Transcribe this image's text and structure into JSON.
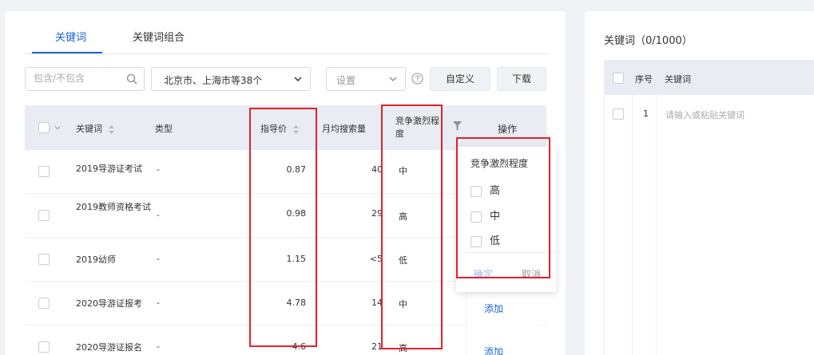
{
  "tabs": [
    {
      "label": "关键词",
      "active": true
    },
    {
      "label": "关键词组合",
      "active": false
    }
  ],
  "toolbar": {
    "search_placeholder": "包含/不包含",
    "region_value": "北京市、上海市等38个",
    "setting_placeholder": "设置",
    "custom_label": "自定义",
    "download_label": "下载"
  },
  "table": {
    "headers": {
      "keyword": "关键词",
      "type": "类型",
      "price": "指导价",
      "volume": "月均搜索量",
      "competition": "竞争激烈程度",
      "operation": "操作"
    },
    "rows": [
      {
        "keyword": "2019导游证考试",
        "type": "-",
        "price": "0.87",
        "volume": "40",
        "competition": "中",
        "op": ""
      },
      {
        "keyword": "2019教师资格考试",
        "type": "-",
        "price": "0.98",
        "volume": "29",
        "competition": "高",
        "op": ""
      },
      {
        "keyword": "2019幼师",
        "type": "-",
        "price": "1.15",
        "volume": "<5",
        "competition": "低",
        "op": ""
      },
      {
        "keyword": "2020导游证报考",
        "type": "-",
        "price": "4.78",
        "volume": "14",
        "competition": "中",
        "op": "添加"
      },
      {
        "keyword": "2020导游证报名",
        "type": "-",
        "price": "4.6",
        "volume": "21",
        "competition": "高",
        "op": "添加"
      }
    ]
  },
  "filter_popup": {
    "title": "竞争激烈程度",
    "options": [
      "高",
      "中",
      "低"
    ],
    "confirm_label": "确定",
    "cancel_label": "取消"
  },
  "right_panel": {
    "title": "关键词（0/1000）",
    "headers": {
      "index": "序号",
      "keyword": "关键词"
    },
    "row": {
      "index": "1",
      "placeholder": "请输入或粘贴关键词"
    }
  },
  "colors": {
    "accent": "#1a64d6",
    "highlight": "#e3212b",
    "header_bg": "#e9ecf3"
  }
}
